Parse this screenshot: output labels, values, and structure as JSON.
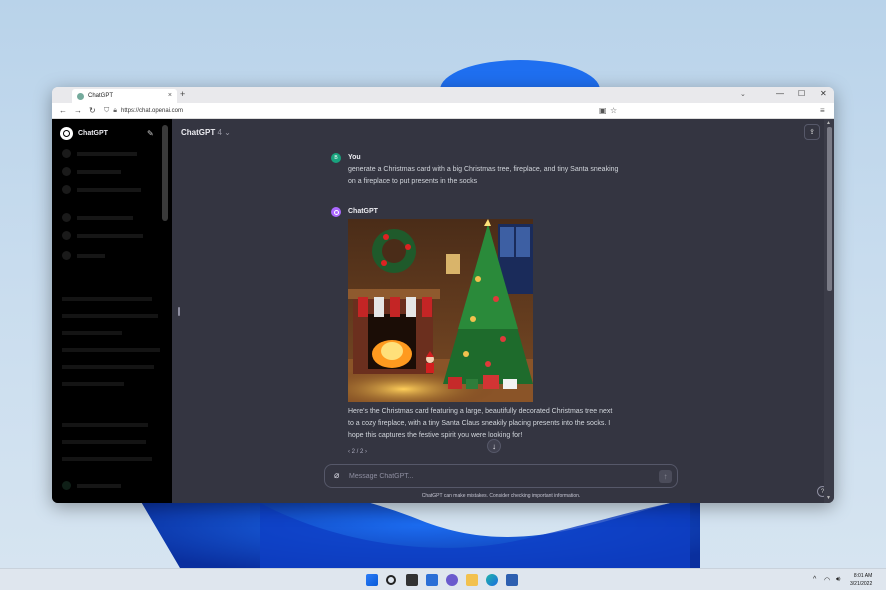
{
  "browser": {
    "tab_title": "ChatGPT",
    "tab_close": "×",
    "new_tab": "+",
    "tab_menu": "⌄",
    "minimize": "—",
    "maximize": "☐",
    "close": "✕",
    "back": "←",
    "forward": "→",
    "reload": "↻",
    "url": "https://chat.openai.com",
    "menu": "≡"
  },
  "sidebar": {
    "title": "ChatGPT",
    "edit_icon": "✎"
  },
  "header": {
    "model_name": "ChatGPT",
    "model_version": "4",
    "chevron": "⌄",
    "share_icon": "⇪"
  },
  "conversation": {
    "user": {
      "avatar_letter": "B",
      "name": "You",
      "message_line1": "generate a Christmas card with a big Christmas tree, fireplace, and tiny Santa sneaking",
      "message_line2": "on a fireplace to put presents in the socks"
    },
    "assistant": {
      "name": "ChatGPT",
      "reply_line1": "Here's the Christmas card featuring a large, beautifully decorated Christmas tree next",
      "reply_line2": "to a cozy fireplace, with a tiny Santa Claus sneakily placing presents into the socks. I",
      "reply_line3": "hope this captures the festive spirit you were looking for!",
      "pager": "‹ 2 / 2 ›"
    },
    "scroll_down": "↓"
  },
  "composer": {
    "placeholder": "Message ChatGPT...",
    "attach_icon": "⌀",
    "send_icon": "↑"
  },
  "disclaimer": "ChatGPT can make mistakes. Consider checking important information.",
  "help": "?",
  "taskbar": {
    "time": "8:01 AM",
    "date": "3/21/2022",
    "tray_chevron": "^"
  },
  "colors": {
    "page_bg": "#343541",
    "sidebar_bg": "#000000",
    "user_avatar": "#19a37e",
    "assistant_avatar": "#ab68ff"
  }
}
